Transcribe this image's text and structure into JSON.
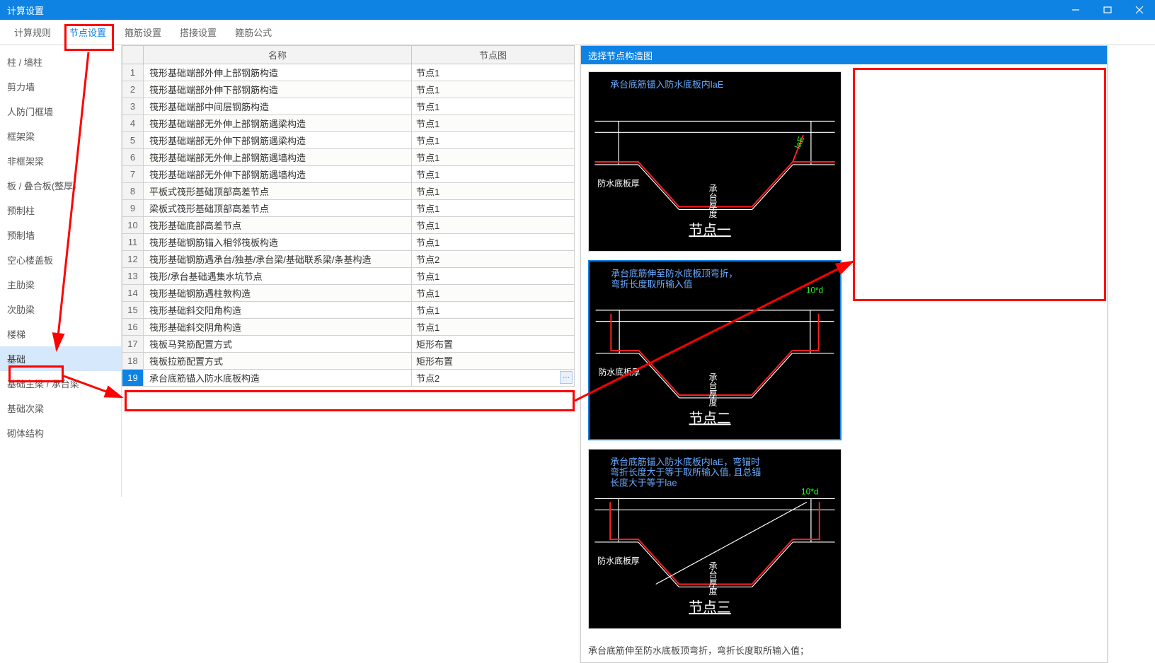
{
  "title": "计算设置",
  "tabs": [
    "计算规则",
    "节点设置",
    "箍筋设置",
    "搭接设置",
    "箍筋公式"
  ],
  "active_tab_index": 1,
  "sidebar": [
    "柱 / 墙柱",
    "剪力墙",
    "人防门框墙",
    "框架梁",
    "非框架梁",
    "板 / 叠合板(整厚)",
    "预制柱",
    "预制墙",
    "空心楼盖板",
    "主肋梁",
    "次肋梁",
    "楼梯",
    "基础",
    "基础主梁 / 承台梁",
    "基础次梁",
    "砌体结构"
  ],
  "sidebar_selected_index": 12,
  "table": {
    "headers": [
      "",
      "名称",
      "节点图"
    ],
    "rows": [
      {
        "n": 1,
        "name": "筏形基础端部外伸上部钢筋构造",
        "val": "节点1"
      },
      {
        "n": 2,
        "name": "筏形基础端部外伸下部钢筋构造",
        "val": "节点1"
      },
      {
        "n": 3,
        "name": "筏形基础端部中间层钢筋构造",
        "val": "节点1"
      },
      {
        "n": 4,
        "name": "筏形基础端部无外伸上部钢筋遇梁构造",
        "val": "节点1"
      },
      {
        "n": 5,
        "name": "筏形基础端部无外伸下部钢筋遇梁构造",
        "val": "节点1"
      },
      {
        "n": 6,
        "name": "筏形基础端部无外伸上部钢筋遇墙构造",
        "val": "节点1"
      },
      {
        "n": 7,
        "name": "筏形基础端部无外伸下部钢筋遇墙构造",
        "val": "节点1"
      },
      {
        "n": 8,
        "name": "平板式筏形基础顶部高差节点",
        "val": "节点1"
      },
      {
        "n": 9,
        "name": "梁板式筏形基础顶部高差节点",
        "val": "节点1"
      },
      {
        "n": 10,
        "name": "筏形基础底部高差节点",
        "val": "节点1"
      },
      {
        "n": 11,
        "name": "筏形基础钢筋锚入相邻筏板构造",
        "val": "节点1"
      },
      {
        "n": 12,
        "name": "筏形基础钢筋遇承台/独基/承台梁/基础联系梁/条基构造",
        "val": "节点2"
      },
      {
        "n": 13,
        "name": "筏形/承台基础遇集水坑节点",
        "val": "节点1"
      },
      {
        "n": 14,
        "name": "筏形基础钢筋遇柱敦构造",
        "val": "节点1"
      },
      {
        "n": 15,
        "name": "筏形基础斜交阳角构造",
        "val": "节点1"
      },
      {
        "n": 16,
        "name": "筏形基础斜交阴角构造",
        "val": "节点1"
      },
      {
        "n": 17,
        "name": "筏板马凳筋配置方式",
        "val": "矩形布置"
      },
      {
        "n": 18,
        "name": "筏板拉筋配置方式",
        "val": "矩形布置"
      },
      {
        "n": 19,
        "name": "承台底筋锚入防水底板构造",
        "val": "节点2"
      }
    ],
    "selected_row_index": 18
  },
  "right": {
    "header": "选择节点构造图",
    "caption": "承台底筋伸至防水底板顶弯折，弯折长度取所输入值；",
    "cards": [
      {
        "title": "节点一",
        "top": "承台底筋锚入防水底板内laE",
        "bl": "防水底板厚",
        "cv": "承台厚度",
        "rg": "laE"
      },
      {
        "title": "节点二",
        "top": "承台底筋伸至防水底板顶弯折，\n弯折长度取所输入值",
        "bl": "防水底板厚",
        "cv": "承台厚度",
        "rg": "10*d"
      },
      {
        "title": "节点三",
        "top": "承台底筋锚入防水底板内laE，弯锚时\n弯折长度大于等于取所输入值, 且总锚\n长度大于等于lae",
        "bl": "防水底板厚",
        "cv": "承台厚度",
        "rg": "10*d"
      }
    ],
    "selected_card_index": 1
  }
}
